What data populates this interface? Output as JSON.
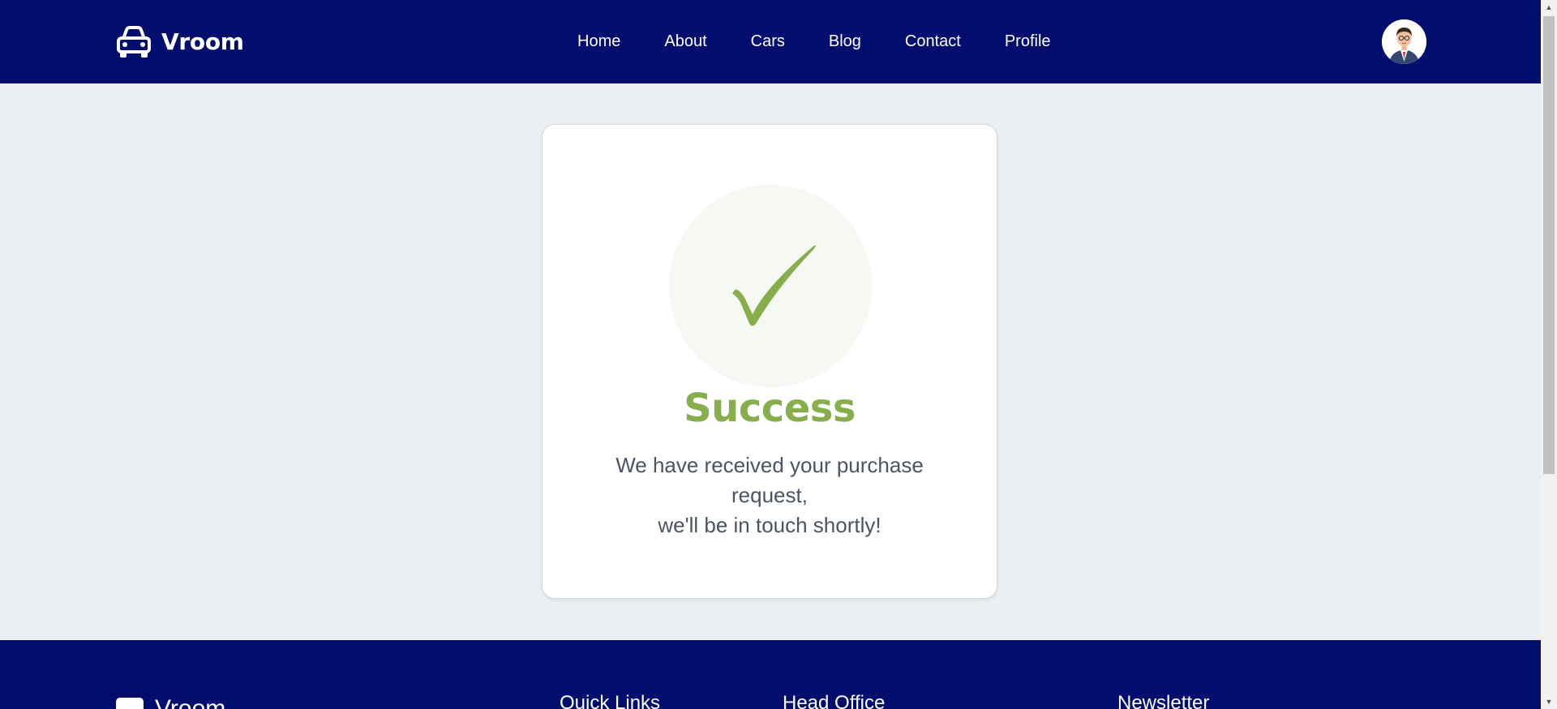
{
  "header": {
    "brand": "Vroom",
    "nav": [
      "Home",
      "About",
      "Cars",
      "Blog",
      "Contact",
      "Profile"
    ]
  },
  "success": {
    "title": "Success",
    "message_lines": [
      "We have received your purchase",
      "request,",
      "we'll be in touch shortly!"
    ]
  },
  "footer": {
    "brand": "Vroom",
    "quick_links": "Quick Links",
    "head_office": "Head Office",
    "newsletter": "Newsletter"
  },
  "colors": {
    "header_bg": "#020e6e",
    "page_bg": "#ebeff3",
    "success_green": "#86ae4b",
    "message_text": "#4a5563"
  },
  "icons": [
    "car-icon",
    "avatar-image",
    "checkmark-icon"
  ]
}
